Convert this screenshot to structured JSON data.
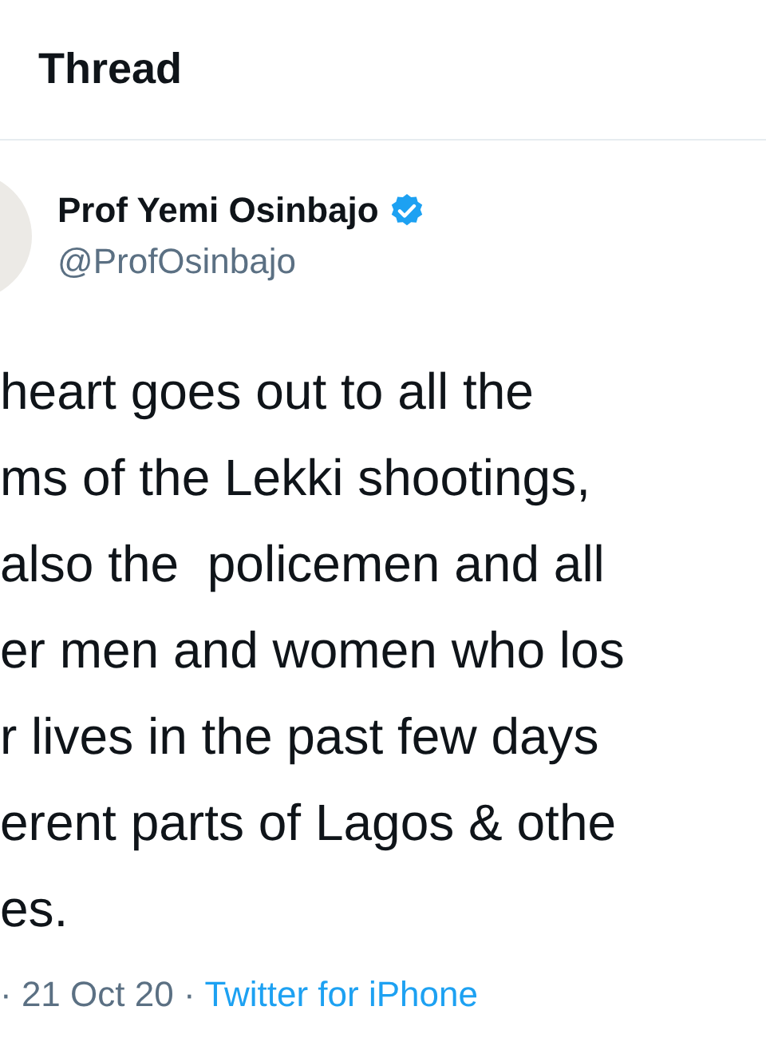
{
  "header": {
    "title": "Thread"
  },
  "author": {
    "name": "Prof Yemi Osinbajo",
    "verified": true,
    "handle": "@ProfOsinbajo"
  },
  "body_lines": [
    "heart goes out to all the",
    "ms of the Lekki shootings,",
    "also the  policemen and all",
    "er men and women who los",
    "r lives in the past few days",
    "erent parts of Lagos & othe",
    "es."
  ],
  "meta": {
    "date": "· 21 Oct 20 ·",
    "source": "Twitter for iPhone"
  }
}
